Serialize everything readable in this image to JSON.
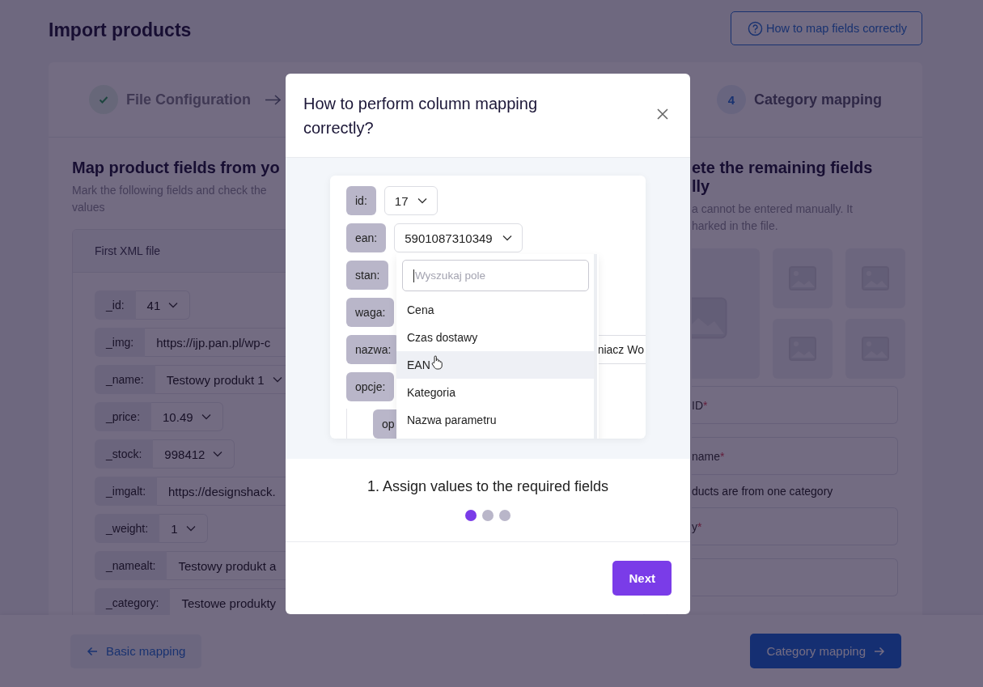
{
  "page": {
    "title": "Import products",
    "help_button": "How to map fields correctly"
  },
  "steps": [
    {
      "label": "File Configuration",
      "done": true
    },
    {
      "number": "4",
      "label": "Category mapping",
      "done": false
    }
  ],
  "left": {
    "heading": "Map product fields from yo",
    "description_lines": [
      "Mark the following fields and check the",
      "values"
    ],
    "panel_title": "First XML file",
    "fields": [
      {
        "label": "_id:",
        "value": "41",
        "kind": "select"
      },
      {
        "label": "_img:",
        "value": "https://ijp.pan.pl/wp-c",
        "kind": "text"
      },
      {
        "label": "_name:",
        "value": "Testowy produkt 1",
        "kind": "select"
      },
      {
        "label": "_price:",
        "value": "10.49",
        "kind": "select"
      },
      {
        "label": "_stock:",
        "value": "998412",
        "kind": "select"
      },
      {
        "label": "_imgalt:",
        "value": "https://designshack.",
        "kind": "text"
      },
      {
        "label": "_weight:",
        "value": "1",
        "kind": "select"
      },
      {
        "label": "_namealt:",
        "value": "Testowy produkt a",
        "kind": "text"
      },
      {
        "label": "_category:",
        "value": "Testowe produkty",
        "kind": "text"
      }
    ]
  },
  "right": {
    "heading": "ete the remaining fields lly",
    "description_lines": [
      "a cannot be entered manually. It",
      "harked in the file."
    ],
    "images": [
      {
        "kind": "large"
      },
      {
        "kind": "small"
      },
      {
        "kind": "small"
      },
      {
        "kind": "small"
      },
      {
        "kind": "small"
      }
    ],
    "items": [
      {
        "kind": "field",
        "label": "ID",
        "required_mark": "*"
      },
      {
        "kind": "field",
        "label": "name",
        "required_mark": "*"
      },
      {
        "kind": "note",
        "label": "ducts are from one category"
      },
      {
        "kind": "field",
        "label": "y",
        "required_mark": "*"
      },
      {
        "kind": "field"
      }
    ]
  },
  "footer": {
    "back_button": "Basic mapping",
    "next_button": "Category mapping"
  },
  "modal": {
    "title": "How to perform column mapping correctly?",
    "demo": {
      "rows": [
        {
          "label": "id:",
          "value": "17",
          "kind": "select"
        },
        {
          "label": "ean:",
          "value": "5901087310349",
          "kind": "select"
        },
        {
          "label": "stan:",
          "kind": "empty"
        },
        {
          "label": "waga:",
          "kind": "empty"
        },
        {
          "label": "nazwa:",
          "value": "niacz Wo",
          "kind": "text"
        },
        {
          "label": "opcje:",
          "kind": "empty"
        },
        {
          "label": "op",
          "kind": "nested"
        }
      ],
      "search_placeholder": "Wyszukaj pole",
      "options": [
        {
          "label": "Cena",
          "hovered": false
        },
        {
          "label": "Czas dostawy",
          "hovered": false
        },
        {
          "label": "EAN",
          "hovered": true
        },
        {
          "label": "Kategoria",
          "hovered": false
        },
        {
          "label": "Nazwa parametru",
          "hovered": false
        }
      ]
    },
    "caption": "1. Assign values to the required fields",
    "dots": [
      {
        "selected": true
      },
      {
        "selected": false
      },
      {
        "selected": false
      }
    ],
    "next_button": "Next"
  }
}
